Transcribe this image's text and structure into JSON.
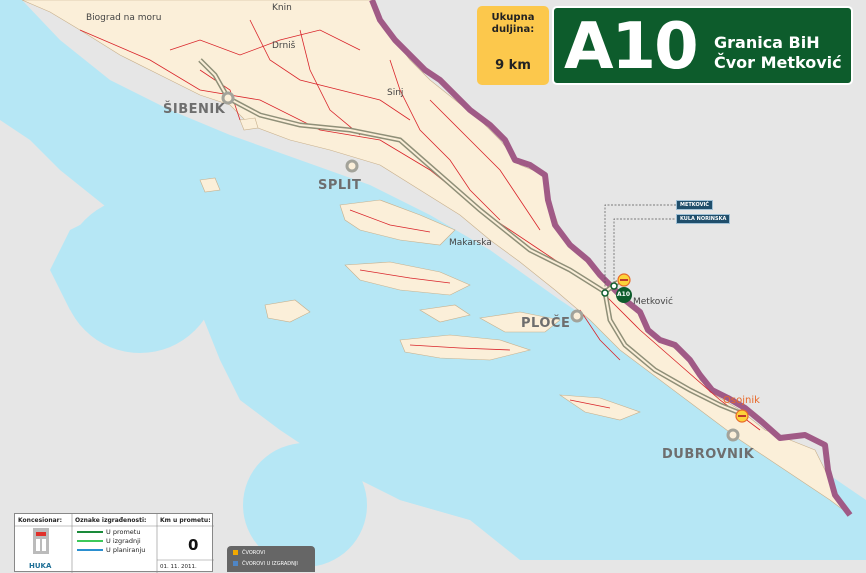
{
  "header": {
    "length_label": "Ukupna duljina:",
    "length_value": "9 km",
    "motorway_code": "A10",
    "route_line1": "Granica BiH",
    "route_line2": "Čvor Metković"
  },
  "places": {
    "biograd": "Biograd na moru",
    "knin": "Knin",
    "drnis": "Drniš",
    "sinj": "Sinj",
    "sibenik": "ŠIBENIK",
    "split": "SPLIT",
    "makarska": "Makarska",
    "ploce": "PLOČE",
    "metkovic": "Metković",
    "osojnik": "Osojnik",
    "dubrovnik": "DUBROVNIK"
  },
  "tags": {
    "metkovic": "METKOVIĆ",
    "kula": "KULA NORINSKA",
    "a10_marker": "A10"
  },
  "legend": {
    "concessionaire_label": "Koncesionar:",
    "status_label": "Oznake izgrađenosti:",
    "km_label": "Km u prometu:",
    "status_items": [
      {
        "label": "U prometu",
        "color": "#1a8a3a"
      },
      {
        "label": "U izgradnji",
        "color": "#3cc85a"
      },
      {
        "label": "U planiranju",
        "color": "#2a8fd0"
      }
    ],
    "km_value": "0",
    "date": "01. 11. 2011.",
    "logo_text": "HUKA"
  },
  "legend2": {
    "items": [
      {
        "label": "ČVOROVI",
        "color": "#f2a900"
      },
      {
        "label": "ČVOROVI U IZGRADNJI",
        "color": "#4f86c6"
      }
    ]
  },
  "colors": {
    "sea": "#b6e7f5",
    "land": "#fbefd9",
    "border": "#a05a86",
    "motorway": "#9c9c84",
    "roads": "#d9242a",
    "sign_green": "#0d5c2c",
    "length_yellow": "#fcc84c"
  }
}
